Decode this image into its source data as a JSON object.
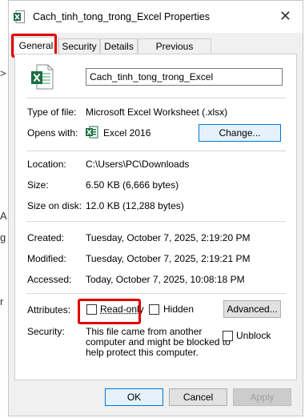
{
  "background_fragments": [
    ">",
    "A",
    "g",
    "r"
  ],
  "window": {
    "title": "Cach_tinh_tong_trong_Excel Properties",
    "close_glyph": "✕"
  },
  "tabs": [
    {
      "label": "General",
      "active": true
    },
    {
      "label": "Security",
      "active": false
    },
    {
      "label": "Details",
      "active": false
    },
    {
      "label": "Previous Versions",
      "active": false
    }
  ],
  "file": {
    "name": "Cach_tinh_tong_trong_Excel",
    "type_label": "Type of file:",
    "type_value": "Microsoft Excel Worksheet (.xlsx)",
    "opens_label": "Opens with:",
    "opens_value": "Excel 2016",
    "change_button": "Change...",
    "location_label": "Location:",
    "location_value": "C:\\Users\\PC\\Downloads",
    "size_label": "Size:",
    "size_value": "6.50 KB (6,666 bytes)",
    "size_disk_label": "Size on disk:",
    "size_disk_value": "12.0 KB (12,288 bytes)",
    "created_label": "Created:",
    "created_value": "Tuesday, October 7, 2025, 2:19:20 PM",
    "modified_label": "Modified:",
    "modified_value": "Tuesday, October 7, 2025, 2:19:21 PM",
    "accessed_label": "Accessed:",
    "accessed_value": "Today, October 7, 2025, 10:08:18 PM"
  },
  "attributes": {
    "label": "Attributes:",
    "readonly": "Read-only",
    "hidden": "Hidden",
    "advanced_button": "Advanced...",
    "readonly_checked": false,
    "hidden_checked": false
  },
  "security": {
    "label": "Security:",
    "message_line1": "This file came from another",
    "message_line2": "computer and might be blocked to",
    "message_line3": "help protect this computer.",
    "unblock": "Unblock"
  },
  "footer": {
    "ok": "OK",
    "cancel": "Cancel",
    "apply": "Apply"
  },
  "colors": {
    "highlight": "#e00000",
    "excel_green": "#1d6f42"
  },
  "icons": {
    "app_icon": "excel-file-icon",
    "opens_icon": "excel-app-icon"
  }
}
